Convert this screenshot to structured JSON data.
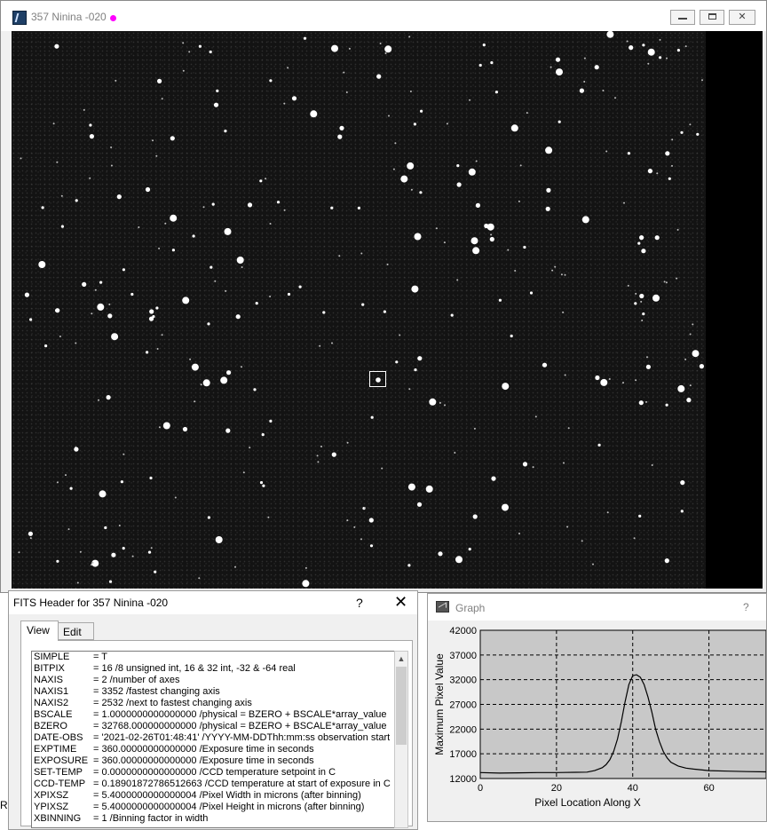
{
  "main_window": {
    "title": "357 Ninina -020",
    "min_symbol": "",
    "close_symbol": "✕"
  },
  "fits": {
    "title": "FITS Header for 357 Ninina -020",
    "help": "?",
    "close": "✕",
    "tabs": [
      "View",
      "Edit"
    ],
    "rows": [
      {
        "key": "SIMPLE",
        "value": "= T"
      },
      {
        "key": "BITPIX",
        "value": "= 16 /8 unsigned int, 16 & 32 int, -32 & -64 real"
      },
      {
        "key": "NAXIS",
        "value": "= 2 /number of axes"
      },
      {
        "key": "NAXIS1",
        "value": "= 3352 /fastest changing axis"
      },
      {
        "key": "NAXIS2",
        "value": "= 2532 /next to fastest changing axis"
      },
      {
        "key": "BSCALE",
        "value": "= 1.0000000000000000 /physical = BZERO + BSCALE*array_value"
      },
      {
        "key": "BZERO",
        "value": "= 32768.000000000000 /physical = BZERO + BSCALE*array_value"
      },
      {
        "key": "DATE-OBS",
        "value": "= '2021-02-26T01:48:41' /YYYY-MM-DDThh:mm:ss observation start"
      },
      {
        "key": "EXPTIME",
        "value": "= 360.00000000000000 /Exposure time in seconds"
      },
      {
        "key": "EXPOSURE",
        "value": "= 360.00000000000000 /Exposure time in seconds"
      },
      {
        "key": "SET-TEMP",
        "value": "= 0.0000000000000000 /CCD temperature setpoint in C"
      },
      {
        "key": "CCD-TEMP",
        "value": "= 0.18901872786512663 /CCD temperature at start of exposure in C"
      },
      {
        "key": "XPIXSZ",
        "value": "= 5.4000000000000004 /Pixel Width in microns (after binning)"
      },
      {
        "key": "YPIXSZ",
        "value": "= 5.4000000000000004 /Pixel Height in microns (after binning)"
      },
      {
        "key": "XBINNING",
        "value": "= 1 /Binning factor in width"
      }
    ]
  },
  "graph": {
    "title": "Graph",
    "help": "?"
  },
  "left_strip_text": "Ri",
  "chart_data": {
    "type": "line",
    "title": "",
    "xlabel": "Pixel Location Along X",
    "ylabel": "Maximum Pixel Value",
    "xlim": [
      0,
      75
    ],
    "ylim": [
      12000,
      42000
    ],
    "x_ticks": [
      0,
      20,
      40,
      60
    ],
    "y_ticks": [
      12000,
      17000,
      22000,
      27000,
      32000,
      37000,
      42000
    ],
    "grid": true,
    "series": [
      {
        "x": [
          0,
          5,
          10,
          15,
          20,
          25,
          28,
          30,
          32,
          33,
          34,
          35,
          36,
          37,
          38,
          39,
          40,
          41,
          42,
          43,
          44,
          45,
          46,
          47,
          48,
          49,
          50,
          52,
          54,
          56,
          60,
          65,
          70,
          75
        ],
        "values": [
          13200,
          13100,
          13150,
          13200,
          13200,
          13250,
          13300,
          13600,
          14200,
          14800,
          15800,
          17500,
          20000,
          23500,
          27500,
          31000,
          32800,
          33000,
          32500,
          31000,
          28500,
          25500,
          22000,
          19500,
          17500,
          16200,
          15300,
          14500,
          14100,
          13900,
          13600,
          13500,
          13400,
          13350
        ]
      }
    ]
  }
}
